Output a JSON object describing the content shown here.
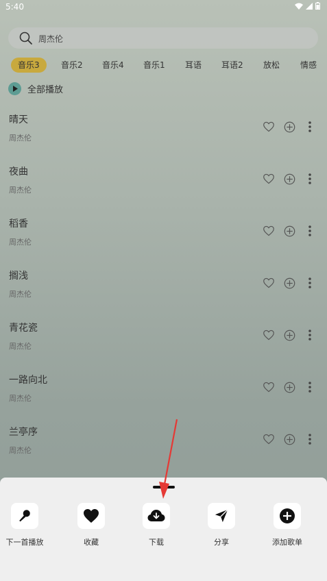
{
  "status": {
    "time": "5:40"
  },
  "search": {
    "query": "周杰伦"
  },
  "tabs": [
    {
      "label": "音乐3",
      "active": true
    },
    {
      "label": "音乐2"
    },
    {
      "label": "音乐4"
    },
    {
      "label": "音乐1"
    },
    {
      "label": "耳语"
    },
    {
      "label": "耳语2"
    },
    {
      "label": "放松"
    },
    {
      "label": "情感"
    }
  ],
  "play_all": {
    "label": "全部播放"
  },
  "songs": [
    {
      "title": "晴天",
      "artist": "周杰伦"
    },
    {
      "title": "夜曲",
      "artist": "周杰伦"
    },
    {
      "title": "稻香",
      "artist": "周杰伦"
    },
    {
      "title": "搁浅",
      "artist": "周杰伦"
    },
    {
      "title": "青花瓷",
      "artist": "周杰伦"
    },
    {
      "title": "一路向北",
      "artist": "周杰伦"
    },
    {
      "title": "兰亭序",
      "artist": "周杰伦"
    }
  ],
  "sheet": {
    "items": [
      {
        "label": "下一首播放",
        "icon": "microphone-icon"
      },
      {
        "label": "收藏",
        "icon": "heart-icon"
      },
      {
        "label": "下载",
        "icon": "cloud-download-icon"
      },
      {
        "label": "分享",
        "icon": "send-icon"
      },
      {
        "label": "添加歌单",
        "icon": "plus-circle-icon"
      }
    ]
  },
  "colors": {
    "accent": "#c8a93e",
    "play": "#5d9c93",
    "arrow": "#e53935"
  }
}
